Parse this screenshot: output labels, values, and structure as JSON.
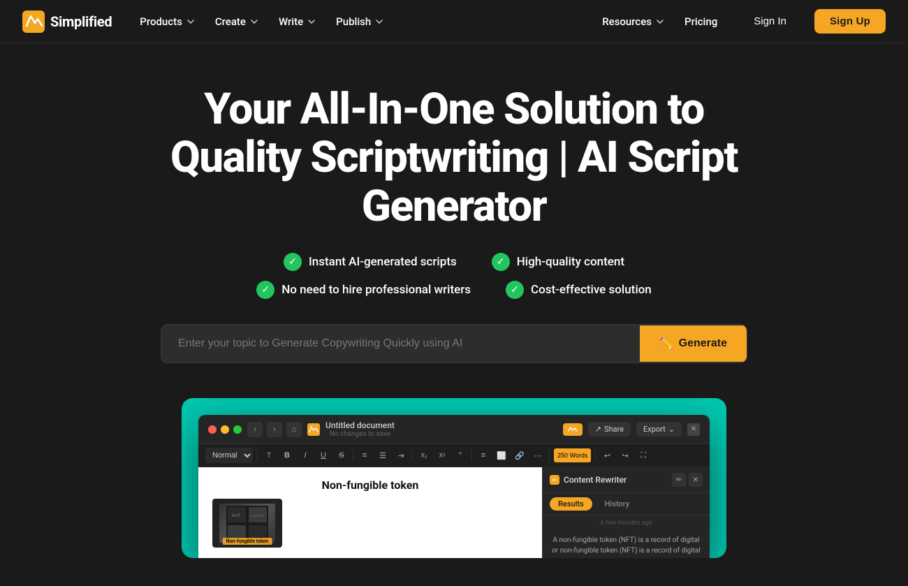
{
  "brand": {
    "name": "Simplified",
    "logo_alt": "Simplified logo"
  },
  "nav": {
    "items": [
      {
        "label": "Products",
        "has_dropdown": true
      },
      {
        "label": "Create",
        "has_dropdown": true
      },
      {
        "label": "Write",
        "has_dropdown": true
      },
      {
        "label": "Publish",
        "has_dropdown": true
      }
    ],
    "right_items": [
      {
        "label": "Resources",
        "has_dropdown": true
      },
      {
        "label": "Pricing",
        "has_dropdown": false
      }
    ],
    "signin_label": "Sign In",
    "signup_label": "Sign Up"
  },
  "hero": {
    "title": "Your All-In-One Solution to Quality Scriptwriting | AI Script Generator",
    "features": [
      {
        "text": "Instant AI-generated scripts"
      },
      {
        "text": "High-quality content"
      },
      {
        "text": "No need to hire professional writers"
      },
      {
        "text": "Cost-effective solution"
      }
    ],
    "search_placeholder": "Enter your topic to Generate Copywriting Quickly using AI",
    "generate_label": "Generate"
  },
  "app_preview": {
    "doc_title": "Untitled document",
    "doc_subtitle": "No changes to save",
    "doc_heading": "Non-fungible token",
    "doc_image_label": "Non-fungible token",
    "panel_title": "Content Rewriter",
    "panel_tab_results": "Results",
    "panel_tab_history": "History",
    "panel_time": "A few minutes ago",
    "panel_text": "A non-fungible token (NFT) is a record of digital or non-fungible token (NFT) is a record of digital or",
    "share_label": "Share",
    "export_label": "Export"
  },
  "colors": {
    "accent": "#f5a623",
    "teal": "#00c8b0",
    "bg": "#1a1a1a",
    "check_green": "#22c55e"
  }
}
